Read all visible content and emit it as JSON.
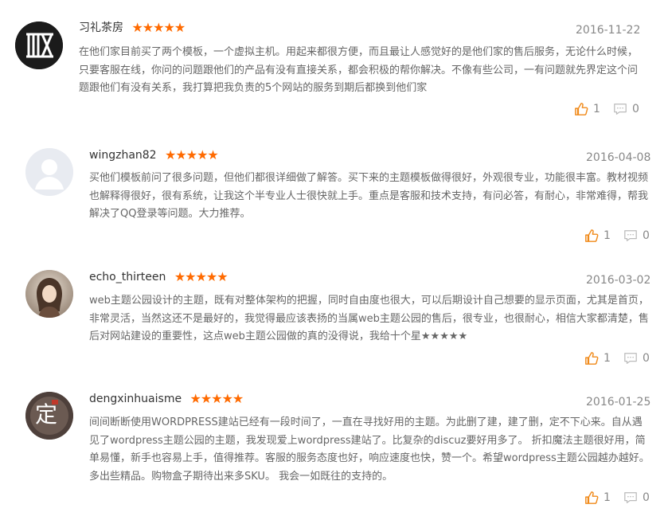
{
  "reviews": [
    {
      "name": "习礼茶房",
      "stars": "★★★★★",
      "date": "2016-11-22",
      "avatar_icon": "ink-logo-avatar",
      "lines": [
        "在他们家目前买了两个模板，一个虚拟主机。用起来都很方便，而且最让人感觉好的是他们家的售后服务，无论什么时候，",
        "只要客服在线，你问的问题跟他们的产品有没有直接关系，都会积极的帮你解决。不像有些公司，一有问题就先界定这个问",
        "题跟他们有没有关系，我打算把我负责的5个网站的服务到期后都换到他们家"
      ],
      "likes": "1",
      "comments": "0"
    },
    {
      "name": "wingzhan82",
      "stars": "★★★★★",
      "date": "2016-04-08",
      "avatar_icon": "default-user-avatar",
      "lines": [
        "买他们模板前问了很多问题，但他们都很详细做了解答。买下来的主题模板做得很好，外观很专业，功能很丰富。教材视频",
        "也解释得很好，很有系统，让我这个半专业人士很快就上手。重点是客服和技术支持，有问必答，有耐心，非常难得，帮我",
        "解决了QQ登录等问题。大力推荐。"
      ],
      "likes": "1",
      "comments": "0"
    },
    {
      "name": "echo_thirteen",
      "stars": "★★★★★",
      "date": "2016-03-02",
      "avatar_icon": "photo-avatar",
      "lines": [
        "web主题公园设计的主题，既有对整体架构的把握，同时自由度也很大，可以后期设计自己想要的显示页面，尤其是首页，",
        "非常灵活，当然这还不是最好的，我觉得最应该表扬的当属web主题公园的售后，很专业，也很耐心，相信大家都清楚，售",
        "后对网站建设的重要性，这点web主题公园做的真的没得说，我给十个星★★★★★"
      ],
      "likes": "1",
      "comments": "0"
    },
    {
      "name": "dengxinhuaisme",
      "stars": "★★★★★",
      "date": "2016-01-25",
      "avatar_icon": "calligraphy-avatar",
      "avatar_text": "定",
      "lines": [
        "间间断断使用WORDPRESS建站已经有一段时间了，一直在寻找好用的主题。为此删了建，建了删，定不下心来。自从遇",
        "见了wordpress主题公园的主题，我发现爱上wordpress建站了。比复杂的discuz要好用多了。 折扣魔法主题很好用，简",
        "单易懂，新手也容易上手，值得推荐。客服的服务态度也好，响应速度也快，赞一个。希望wordpress主题公园越办越好。",
        "多出些精品。购物盒子期待出来多SKU。 我会一如既往的支持的。"
      ],
      "likes": "1",
      "comments": "0"
    }
  ]
}
